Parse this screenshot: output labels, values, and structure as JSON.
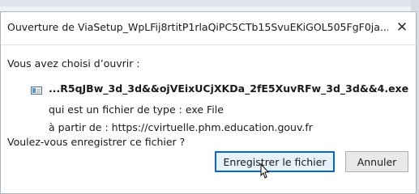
{
  "dialog": {
    "title": "Ouverture de ViaSetup_WpLFij8rtitP1rlaQiPC5CTb15SvuEKiGOL505FgF0ja...",
    "close_glyph": "✕",
    "intro": "Vous avez choisi d’ouvrir :",
    "file_name": "...R5qJBw_3d_3d&&ojVEixUCjXKDa_2fE5XuvRFw_3d_3d&&4.exe",
    "file_type_label": "qui est un fichier de type :",
    "file_type_value": "exe File",
    "source_label": "à partir de :",
    "source_value": "https://cvirtuelle.phm.education.gouv.fr",
    "question": "Voulez-vous enregistrer ce fichier ?",
    "save_button": "Enregistrer le fichier",
    "cancel_button": "Annuler"
  },
  "icons": {
    "file": "file-icon",
    "close": "close-icon",
    "cursor": "mouse-cursor-icon"
  },
  "colors": {
    "primary_button_border": "#0a64d6",
    "primary_button_bg": "#e5f1fb"
  }
}
